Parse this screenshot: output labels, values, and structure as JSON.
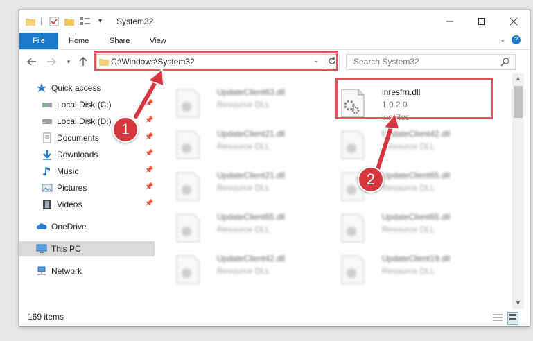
{
  "window": {
    "title": "System32"
  },
  "ribbon": {
    "tabs": [
      {
        "label": "File"
      },
      {
        "label": "Home"
      },
      {
        "label": "Share"
      },
      {
        "label": "View"
      }
    ]
  },
  "address": {
    "path": "C:\\Windows\\System32"
  },
  "search": {
    "placeholder": "Search System32"
  },
  "sidebar": {
    "items": [
      {
        "label": "Quick access",
        "icon": "star-icon"
      },
      {
        "label": "Local Disk (C:)",
        "icon": "drive-icon",
        "pinned": true
      },
      {
        "label": "Local Disk (D:)",
        "icon": "drive-icon",
        "pinned": true
      },
      {
        "label": "Documents",
        "icon": "documents-icon",
        "pinned": true
      },
      {
        "label": "Downloads",
        "icon": "download-icon",
        "pinned": true
      },
      {
        "label": "Music",
        "icon": "music-icon",
        "pinned": true
      },
      {
        "label": "Pictures",
        "icon": "pictures-icon",
        "pinned": true
      },
      {
        "label": "Videos",
        "icon": "video-icon",
        "pinned": true
      },
      {
        "label": "OneDrive",
        "icon": "cloud-icon"
      },
      {
        "label": "This PC",
        "icon": "computer-icon",
        "selected": true
      },
      {
        "label": "Network",
        "icon": "network-icon"
      }
    ]
  },
  "files": [
    {
      "name": "UpdateClient63.dll",
      "sub": "Resource DLL",
      "blurred": true
    },
    {
      "name": "inresfrn.dll",
      "sub": "1.0.2.0",
      "sub2": "instRes",
      "blurred": false
    },
    {
      "name": "UpdateClient21.dll",
      "sub": "Resource DLL",
      "blurred": true
    },
    {
      "name": "UpdateClient42.dll",
      "sub": "Resource DLL",
      "blurred": true
    },
    {
      "name": "UpdateClient21.dll",
      "sub": "Resource DLL",
      "blurred": true
    },
    {
      "name": "UpdateClient65.dll",
      "sub": "Resource DLL",
      "blurred": true
    },
    {
      "name": "UpdateClient65.dll",
      "sub": "Resource DLL",
      "blurred": true
    },
    {
      "name": "UpdateClient65.dll",
      "sub": "Resource DLL",
      "blurred": true
    },
    {
      "name": "UpdateClient42.dll",
      "sub": "Resource DLL",
      "blurred": true
    },
    {
      "name": "UpdateClient19.dll",
      "sub": "Resource DLL",
      "blurred": true
    }
  ],
  "status": {
    "count": "169 items"
  },
  "annotations": {
    "step1": "1",
    "step2": "2",
    "highlight_color": "#e0545b",
    "badge_color": "#d8363e"
  },
  "colors": {
    "accent": "#1979ca",
    "selected_bg": "#d9d9d9"
  }
}
